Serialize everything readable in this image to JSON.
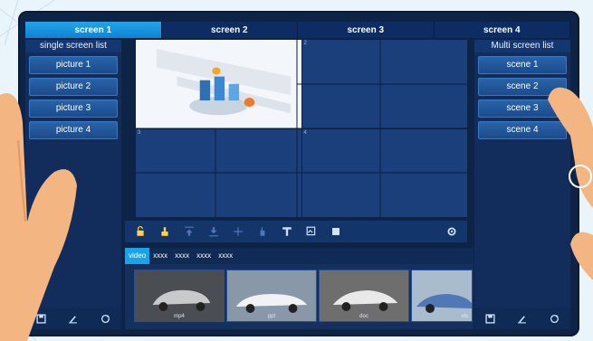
{
  "tabs": [
    {
      "label": "screen 1",
      "active": true
    },
    {
      "label": "screen 2",
      "active": false
    },
    {
      "label": "screen 3",
      "active": false
    },
    {
      "label": "screen 4",
      "active": false
    }
  ],
  "left_panel": {
    "title": "single screen list",
    "items": [
      "picture 1",
      "picture 2",
      "picture 3",
      "picture 4"
    ]
  },
  "right_panel": {
    "title": "Multi screen list",
    "items": [
      "scene 1",
      "scene 2",
      "scene 3",
      "scene 4"
    ]
  },
  "grid_numbers": [
    "2",
    "3",
    "4"
  ],
  "toolbar_icons": [
    "unlock-icon",
    "brush-icon",
    "move-top-icon",
    "move-bottom-icon",
    "resize-icon",
    "hand-icon",
    "text-icon",
    "image-edit-icon",
    "stop-icon",
    "settings-icon"
  ],
  "media_tabs": [
    {
      "label": "video",
      "active": true
    },
    {
      "label": "xxxx",
      "active": false
    },
    {
      "label": "xxxx",
      "active": false
    },
    {
      "label": "xxxx",
      "active": false
    },
    {
      "label": "xxxx",
      "active": false
    }
  ],
  "thumbnails": [
    {
      "label": "mp4"
    },
    {
      "label": "ppt"
    },
    {
      "label": "doc"
    },
    {
      "label": "xls"
    }
  ],
  "colors": {
    "accent": "#1aa3e8",
    "panel": "#122d5b",
    "button": "#1b4b8c",
    "skin": "#f3b582"
  }
}
